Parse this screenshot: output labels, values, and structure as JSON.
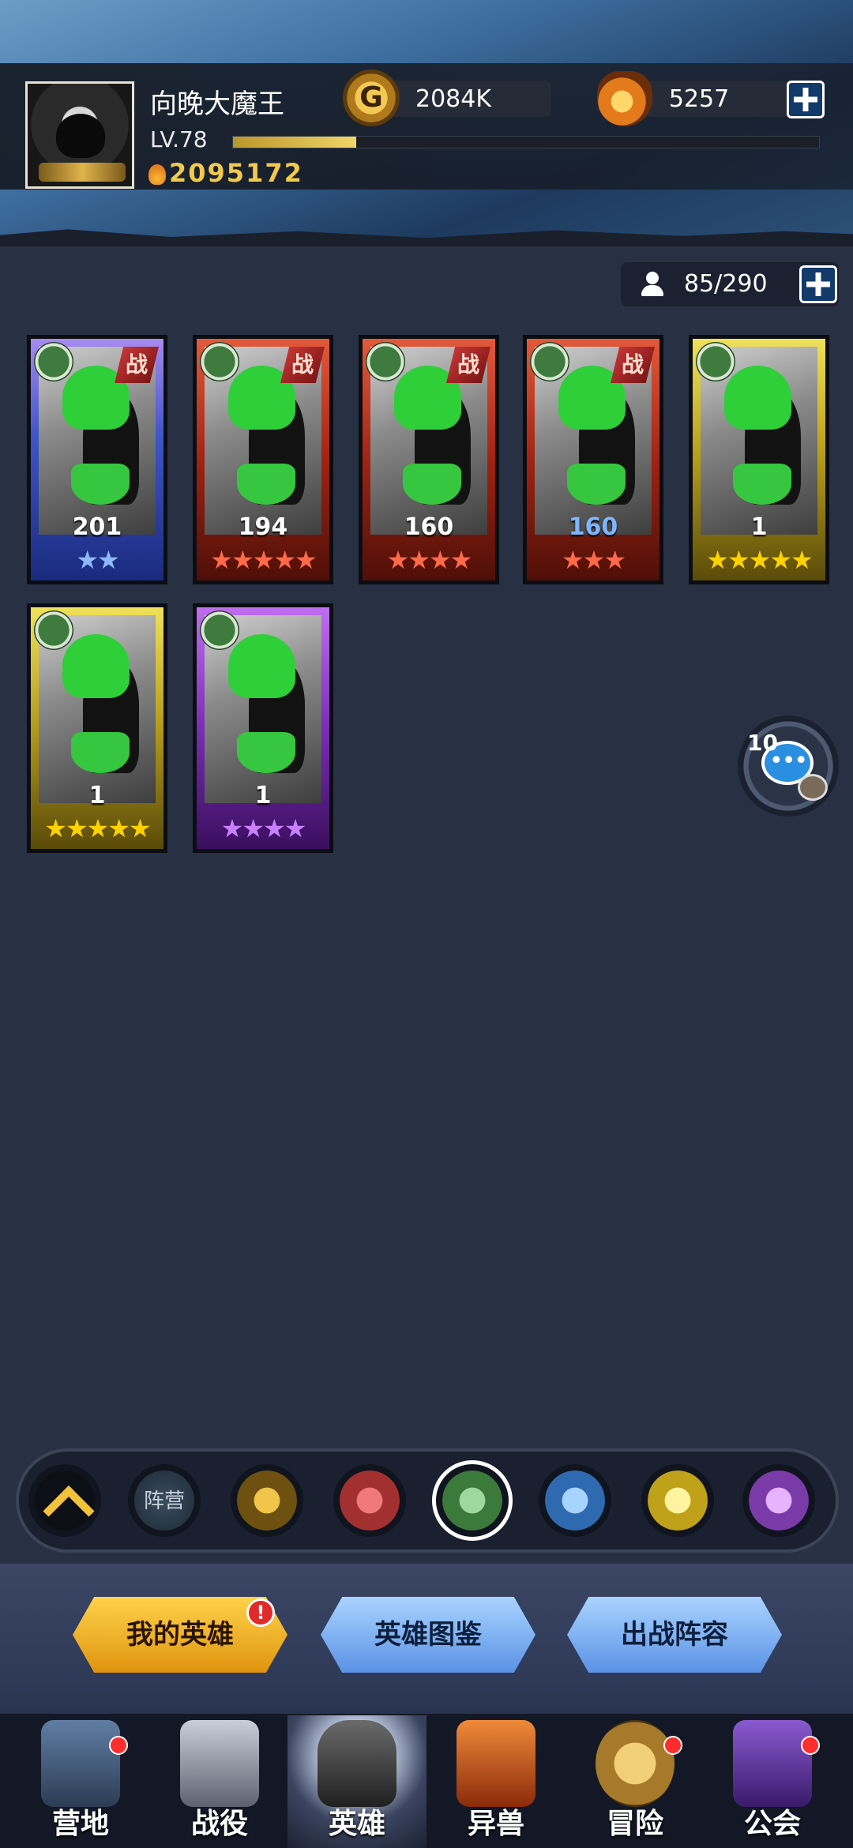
{
  "player": {
    "name": "向晚大魔王",
    "level": "LV.78",
    "level_progress": 0.21,
    "power": "2095172"
  },
  "resources": {
    "gold": "2084K",
    "gems": "5257"
  },
  "hero_count": "85/290",
  "heroes": [
    {
      "level": "201",
      "stars": "★★",
      "frame": "blue",
      "battle": "战"
    },
    {
      "level": "194",
      "stars": "★★★★★",
      "frame": "red",
      "battle": "战"
    },
    {
      "level": "160",
      "stars": "★★★★",
      "frame": "red",
      "battle": "战"
    },
    {
      "level": "160",
      "stars": "★★★",
      "frame": "red",
      "battle": "战"
    },
    {
      "level": "1",
      "stars": "★★★★★",
      "frame": "gold"
    },
    {
      "level": "1",
      "stars": "★★★★★",
      "frame": "gold"
    },
    {
      "level": "1",
      "stars": "★★★★",
      "frame": "purple"
    }
  ],
  "chat": {
    "count": "10"
  },
  "filters": {
    "faction_label": "阵营",
    "items": [
      "top-icon",
      "faction",
      "light-icon",
      "fire-icon",
      "nature-icon",
      "water-icon",
      "holy-icon",
      "dark-icon"
    ]
  },
  "tabs": {
    "my_heroes": "我的英雄",
    "hero_dex": "英雄图鉴",
    "lineup": "出战阵容",
    "alert": "!"
  },
  "nav": [
    "营地",
    "战役",
    "英雄",
    "异兽",
    "冒险",
    "公会"
  ],
  "colors": {
    "background": "#283044",
    "gold_text": "#f2c94c",
    "star_gold": "#ffd200",
    "star_red": "#ff6a4a",
    "star_blue": "#8fb9ff",
    "star_purple": "#c880ff",
    "tab_active": "#f5b52a",
    "tab_inactive": "#7fb1f0"
  }
}
